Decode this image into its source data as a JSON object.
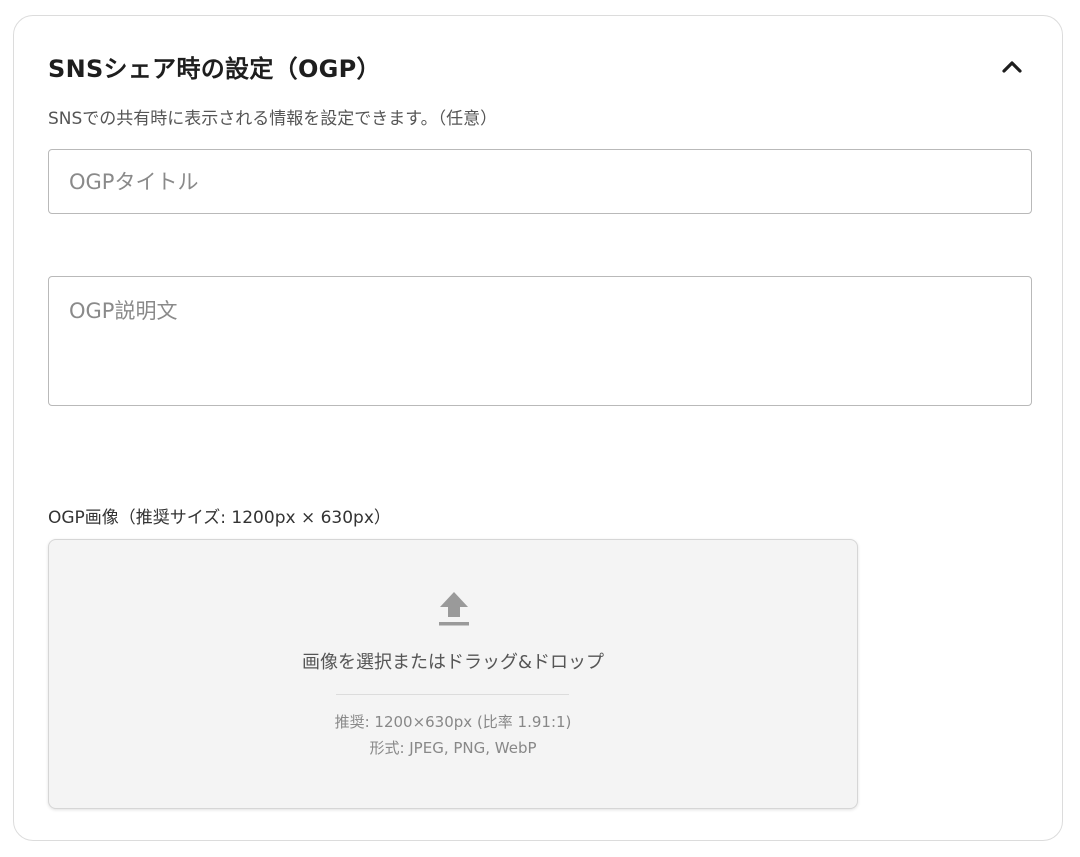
{
  "section": {
    "title": "SNSシェア時の設定（OGP）",
    "description": "SNSでの共有時に表示される情報を設定できます。（任意）",
    "collapse_icon": "chevron-up-icon"
  },
  "ogp_title": {
    "placeholder": "OGPタイトル",
    "value": ""
  },
  "ogp_description": {
    "placeholder": "OGP説明文",
    "value": ""
  },
  "ogp_image": {
    "label": "OGP画像（推奨サイズ: 1200px × 630px）",
    "dropzone_icon": "upload-icon",
    "dropzone_text": "画像を選択またはドラッグ&ドロップ",
    "hint_size": "推奨: 1200×630px (比率 1.91:1)",
    "hint_formats": "形式: JPEG, PNG, WebP"
  },
  "colors": {
    "icon_gray": "#9a9a9a",
    "dropzone_bg": "#f4f4f4",
    "border": "#b9b9b9"
  }
}
